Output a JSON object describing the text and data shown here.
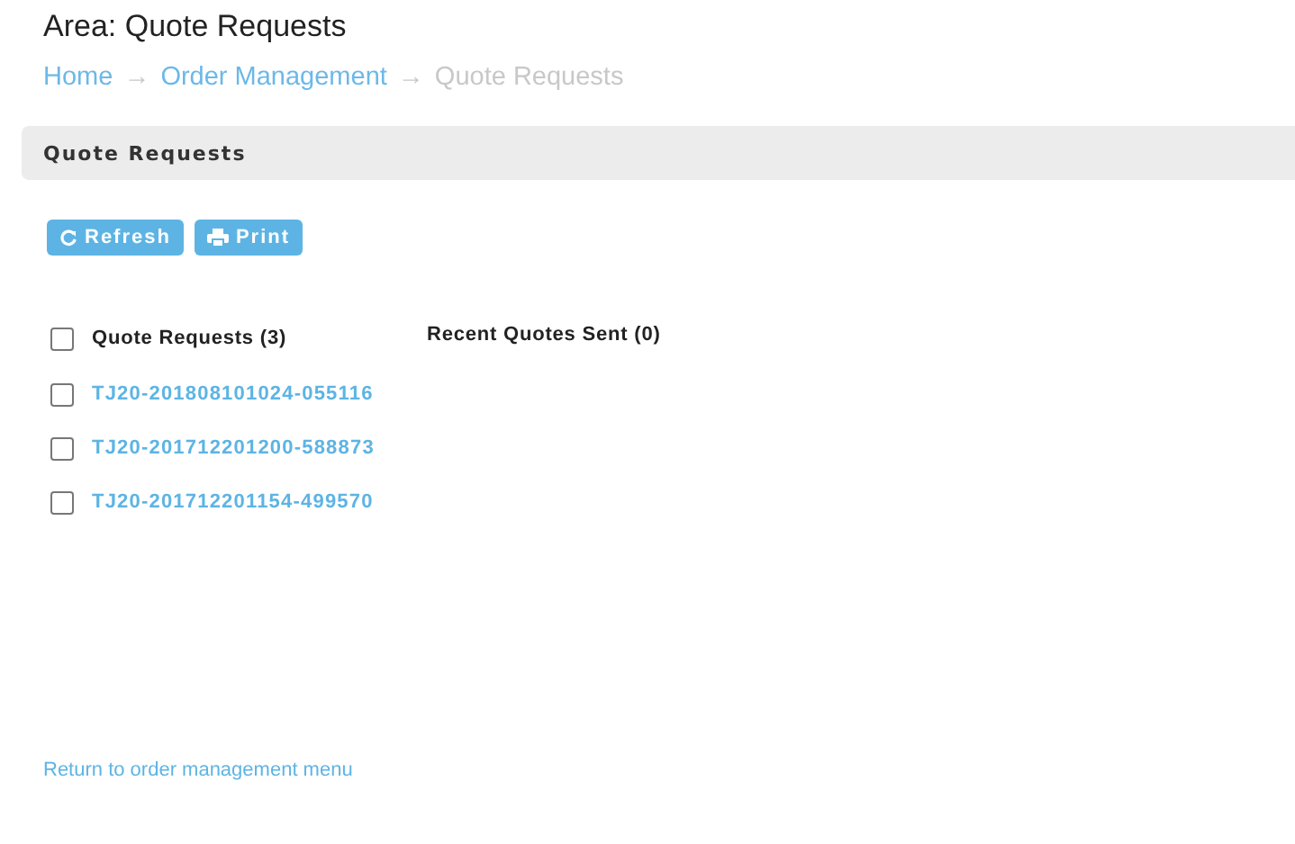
{
  "title": "Area: Quote Requests",
  "breadcrumb": [
    {
      "label": "Home",
      "current": false
    },
    {
      "label": "Order Management",
      "current": false
    },
    {
      "label": "Quote Requests",
      "current": true
    }
  ],
  "breadcrumb_separator": "→",
  "panel": {
    "title": "Quote Requests"
  },
  "buttons": [
    {
      "label": "Refresh",
      "kind": "refresh"
    },
    {
      "label": "Print",
      "kind": "print"
    }
  ],
  "requests": {
    "header": "Quote Requests (3)",
    "checked": false,
    "items": [
      {
        "label": "TJ20-201808101024-055116",
        "checked": false
      },
      {
        "label": "TJ20-201712201200-588873",
        "checked": false
      },
      {
        "label": "TJ20-201712201154-499570",
        "checked": false
      }
    ]
  },
  "recent": {
    "header": "Recent Quotes Sent (0)"
  },
  "footer_link": "Return to order management menu"
}
